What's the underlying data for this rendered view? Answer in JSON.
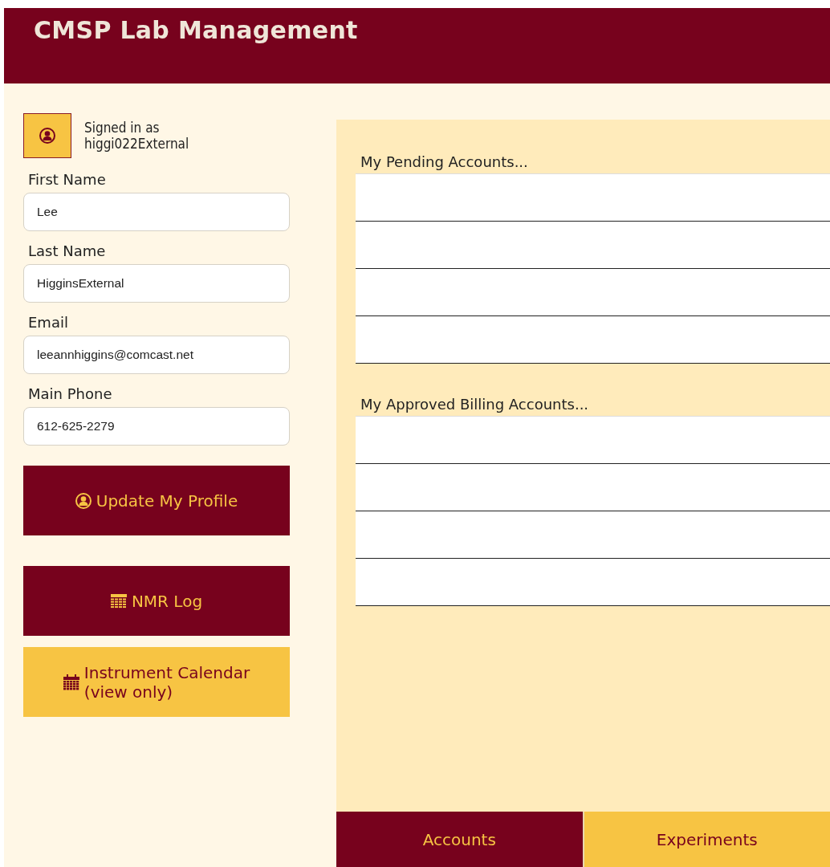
{
  "header": {
    "title": "CMSP Lab Management"
  },
  "user": {
    "signed_in_label": "Signed in as",
    "username": "higgi022External"
  },
  "fields": [
    {
      "label": "First Name",
      "value": "Lee"
    },
    {
      "label": "Last Name",
      "value": "HigginsExternal"
    },
    {
      "label": "Email",
      "value": "leeannhiggins@comcast.net"
    },
    {
      "label": "Main Phone",
      "value": "612-625-2279"
    }
  ],
  "buttons": [
    {
      "label": "Update My Profile",
      "kind": "profile"
    },
    {
      "label": "NMR Log",
      "kind": "log"
    },
    {
      "label": "Instrument Calendar\n(view only)",
      "kind": "calendar"
    }
  ],
  "tables": [
    {
      "title": "My Pending Accounts...",
      "rows": [
        {
          "blank": true
        },
        {
          "blank": true
        },
        {
          "blank": true
        },
        {
          "blank": true
        }
      ]
    },
    {
      "title": "My Approved Billing Accounts...",
      "rows": [
        {
          "blank": true
        },
        {
          "blank": true
        },
        {
          "blank": true
        },
        {
          "blank": true
        }
      ]
    }
  ],
  "tabs": [
    {
      "label": "Accounts",
      "selected": true
    },
    {
      "label": "Experiments",
      "selected": false
    }
  ]
}
